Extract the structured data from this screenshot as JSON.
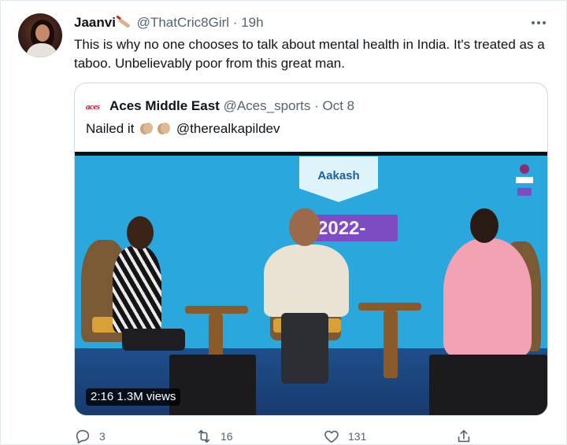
{
  "tweet": {
    "display_name": "Jaanvi",
    "handle": "@ThatCric8Girl",
    "separator": "·",
    "time": "19h",
    "text": "This is why no one chooses to talk about mental health in India. It's treated as a taboo. Unbelievably poor from this great man."
  },
  "quoted": {
    "logo_text": "aces",
    "display_name": "Aces Middle East",
    "handle": "@Aces_sports",
    "separator": "·",
    "date": "Oct 8",
    "text_prefix": "Nailed it",
    "mention": "@therealkapildev",
    "video": {
      "duration": "2:16",
      "views": "1.3M views",
      "sponsor_text": "Aakash",
      "banner_text": "2022-"
    }
  },
  "actions": {
    "replies": "3",
    "retweets": "16",
    "likes": "131"
  },
  "colors": {
    "text": "#0f1419",
    "muted": "#536471",
    "border": "#cfd9de",
    "stage_blue": "#2aa7dd"
  },
  "icons": [
    "cricket-bat-icon",
    "more-icon",
    "clap-icon",
    "reply-icon",
    "retweet-icon",
    "like-icon",
    "share-icon"
  ]
}
